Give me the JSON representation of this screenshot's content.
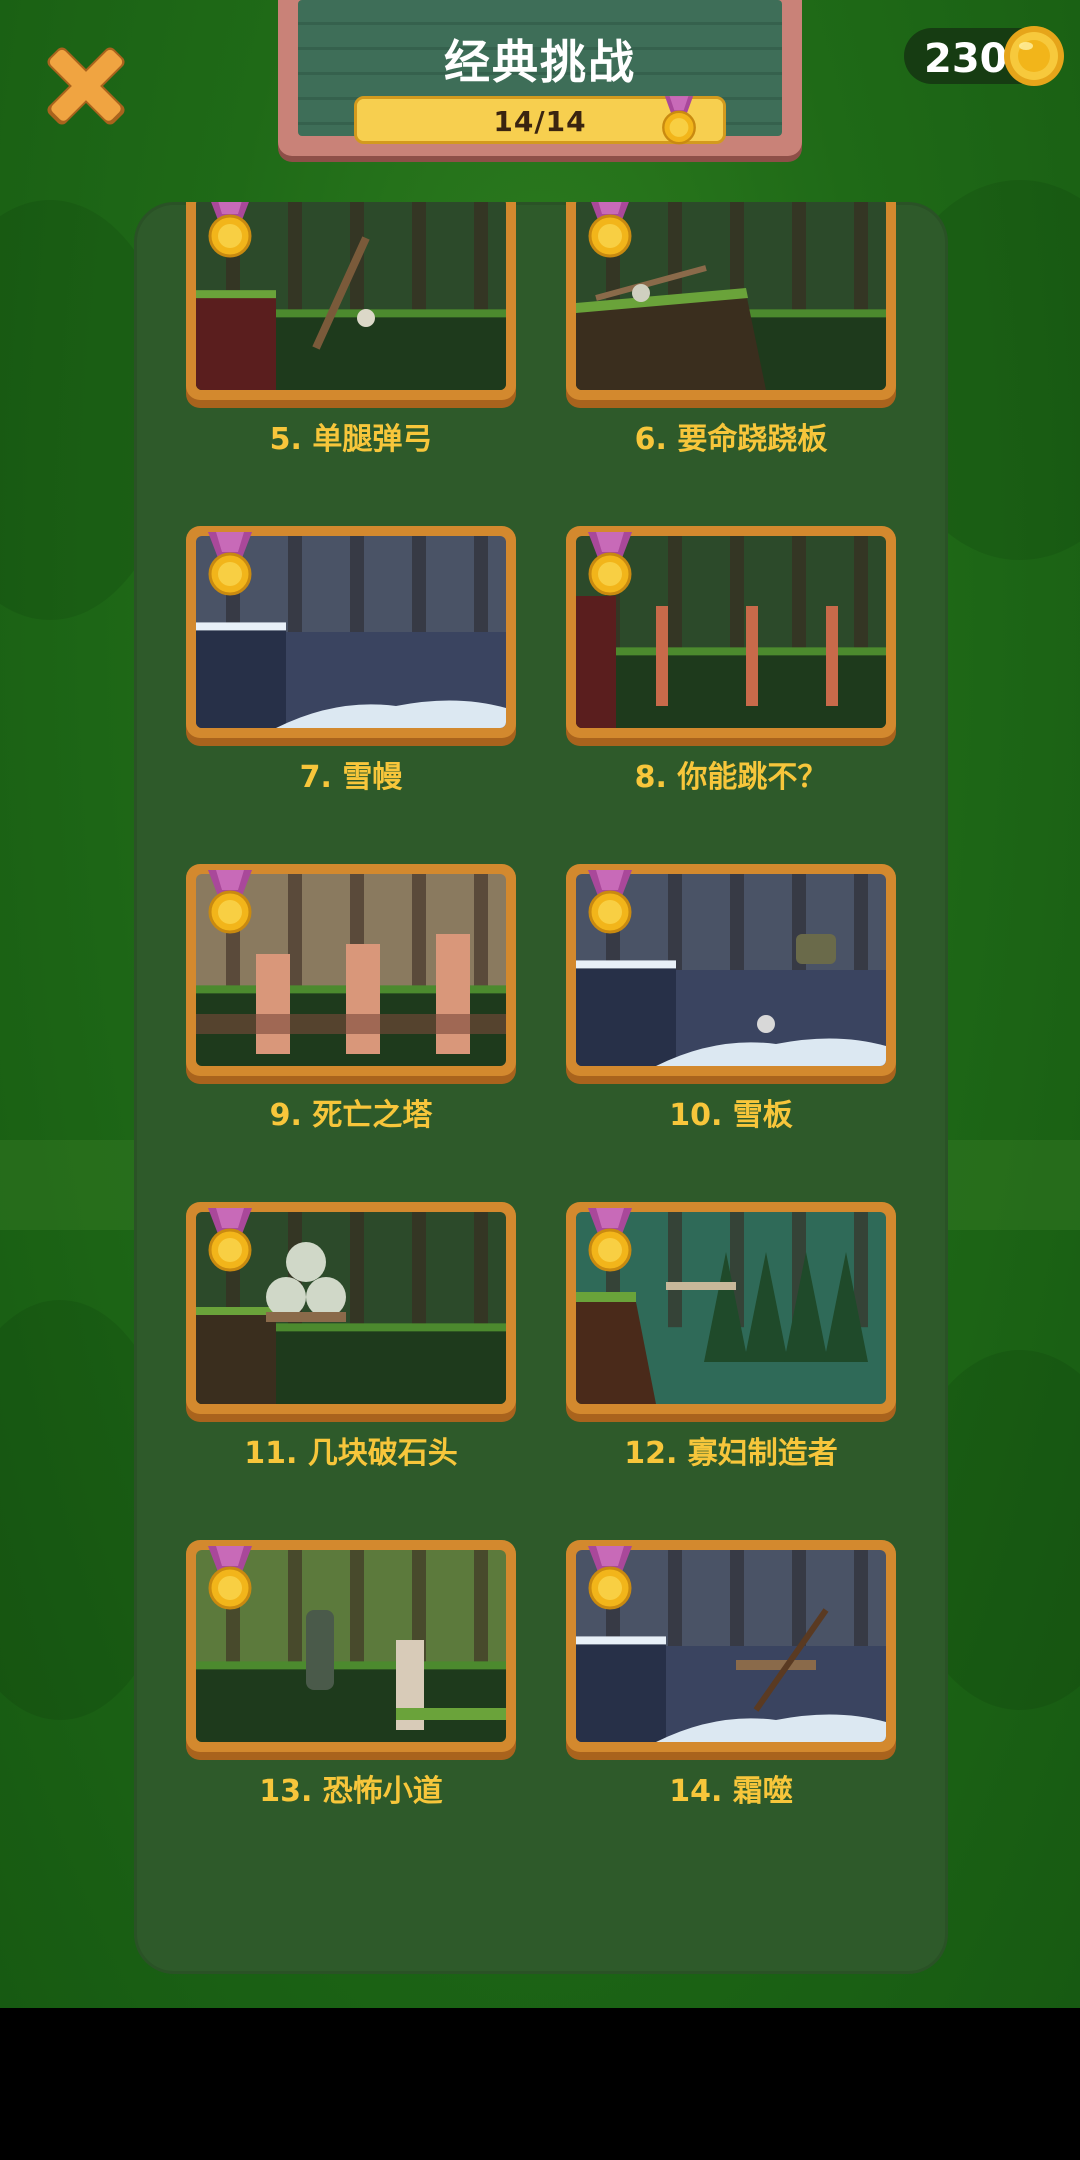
{
  "header": {
    "title": "经典挑战",
    "progress_text": "14/14",
    "progress_fraction": 1.0
  },
  "currency": {
    "coins": "230"
  },
  "levels": [
    {
      "label": "5. 单腿弹弓",
      "scene": "forest-catapult"
    },
    {
      "label": "6. 要命跷跷板",
      "scene": "forest-seesaw"
    },
    {
      "label": "7. 雪幔",
      "scene": "snow-pit"
    },
    {
      "label": "8. 你能跳不？",
      "scene": "forest-pillars"
    },
    {
      "label": "9. 死亡之塔",
      "scene": "towers"
    },
    {
      "label": "10. 雪板",
      "scene": "snow-board"
    },
    {
      "label": "11. 几块破石头",
      "scene": "boulders"
    },
    {
      "label": "12. 寡妇制造者",
      "scene": "pine-slope"
    },
    {
      "label": "13. 恐怖小道",
      "scene": "jungle-path"
    },
    {
      "label": "14. 霜噬",
      "scene": "snow-catapult"
    }
  ],
  "colors": {
    "background": "#1f6a17",
    "panel": "#2e5a2a",
    "frame": "#d3892e",
    "label": "#f7c63b",
    "medal_ribbon": "#a9489a",
    "medal_gold": "#f2b51a"
  },
  "icons": [
    "close-icon",
    "coin-icon",
    "medal-icon"
  ]
}
